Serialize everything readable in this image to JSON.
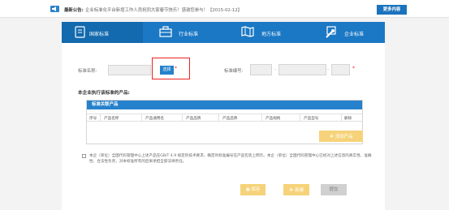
{
  "notice": {
    "label": "最新公告:",
    "text": "企业标准化平台新增工作人员祝同大家春节快乐！感谢您参与！【2015-02-12】",
    "more_button": "更多内容"
  },
  "tabs": [
    {
      "label": "国家标准",
      "icon": "book-icon",
      "active": true
    },
    {
      "label": "行业标准",
      "icon": "briefcase-icon",
      "active": false
    },
    {
      "label": "地方标准",
      "icon": "map-icon",
      "active": false
    },
    {
      "label": "企业标准",
      "icon": "wrench-icon",
      "active": false
    }
  ],
  "form": {
    "name_label": "标准名称:",
    "select_button": "选择",
    "code_label": "标准编号:",
    "required_mark": "*",
    "separator": "-"
  },
  "section_title": "本企业执行该标准的产品:",
  "table": {
    "title": "标准关联产品",
    "headers": [
      "序号",
      "产品名称",
      "产品通用名",
      "产品品牌",
      "产品品牌",
      "产品规格",
      "产品型号",
      "删除"
    ]
  },
  "add_product_button": "添加产品",
  "statement": "本企（单位）全国代码管理中心上述产品在GB/T 4.9 规定的技术要求，确定的标准编号在产品包装上明示。本企（单位）全国代码管理中心已经对上述信息的真实性、准确性、合法性负责，对本标准所有的后果承担全部法律责任。",
  "buttons": {
    "save": "保存",
    "new": "新建",
    "submit": "提交"
  },
  "colors": {
    "primary_blue": "#1b78c4",
    "button_blue": "#2581cb",
    "yellow": "#f6d37a",
    "highlight_red": "#e22"
  }
}
